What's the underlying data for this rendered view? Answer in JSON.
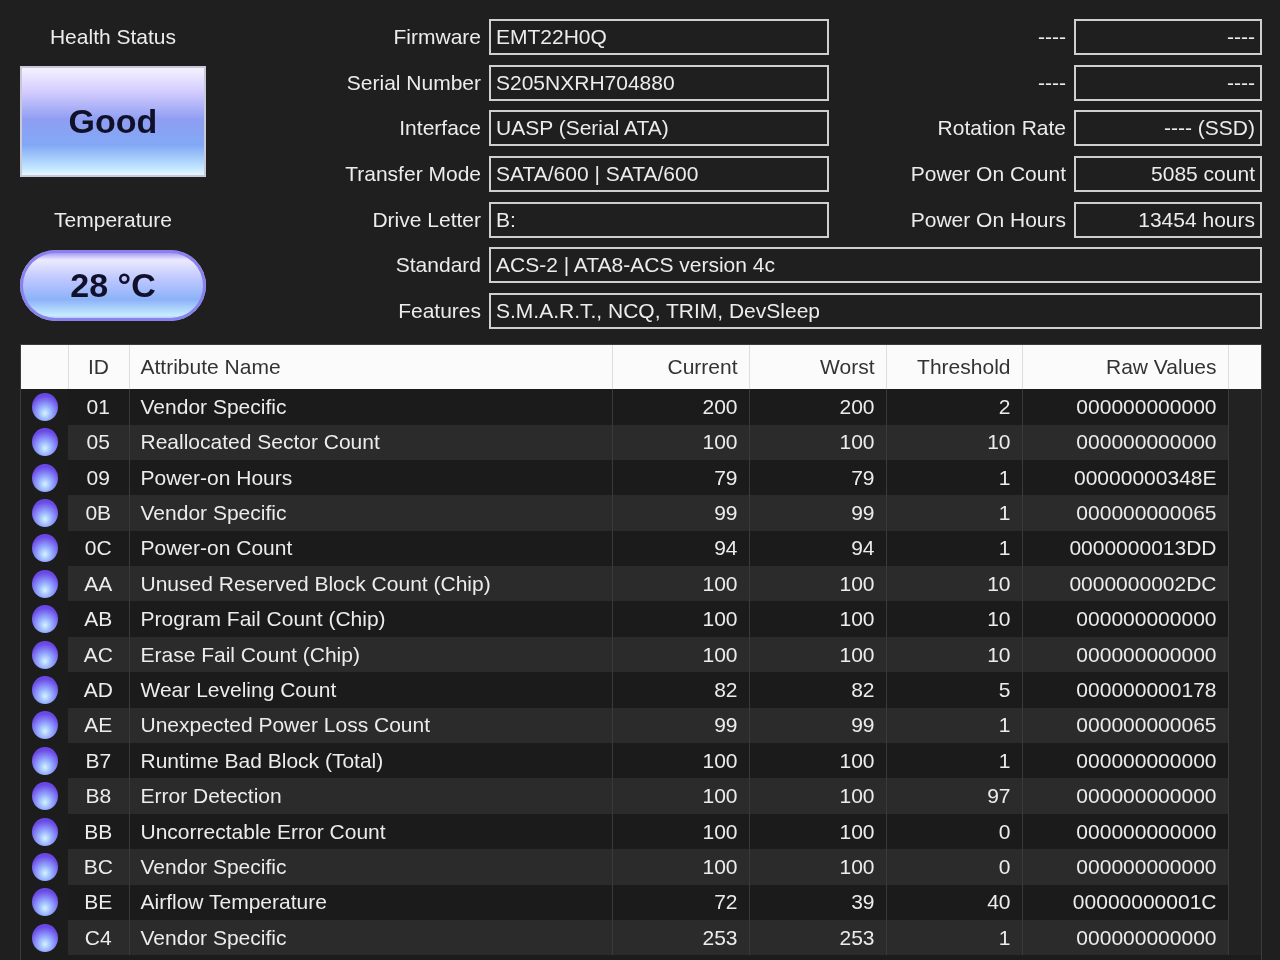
{
  "health_status": {
    "label": "Health Status",
    "value": "Good"
  },
  "temperature": {
    "label": "Temperature",
    "value": "28 °C"
  },
  "details": [
    {
      "label": "Firmware",
      "value": "EMT22H0Q"
    },
    {
      "label": "Serial Number",
      "value": "S205NXRH704880"
    },
    {
      "label": "Interface",
      "value": "UASP (Serial ATA)"
    },
    {
      "label": "Transfer Mode",
      "value": "SATA/600 | SATA/600"
    },
    {
      "label": "Drive Letter",
      "value": "B:"
    }
  ],
  "side_details": [
    {
      "label": "----",
      "value": "----"
    },
    {
      "label": "----",
      "value": "----"
    },
    {
      "label": "Rotation Rate",
      "value": "---- (SSD)"
    },
    {
      "label": "Power On Count",
      "value": "5085 count"
    },
    {
      "label": "Power On Hours",
      "value": "13454 hours"
    }
  ],
  "wide_details": [
    {
      "label": "Standard",
      "value": "ACS-2 | ATA8-ACS version 4c"
    },
    {
      "label": "Features",
      "value": "S.M.A.R.T., NCQ, TRIM, DevSleep"
    }
  ],
  "smart_table": {
    "columns": [
      "ID",
      "Attribute Name",
      "Current",
      "Worst",
      "Threshold",
      "Raw Values"
    ],
    "rows": [
      {
        "id": "01",
        "name": "Vendor Specific",
        "current": "200",
        "worst": "200",
        "threshold": "2",
        "raw": "000000000000"
      },
      {
        "id": "05",
        "name": "Reallocated Sector Count",
        "current": "100",
        "worst": "100",
        "threshold": "10",
        "raw": "000000000000"
      },
      {
        "id": "09",
        "name": "Power-on Hours",
        "current": "79",
        "worst": "79",
        "threshold": "1",
        "raw": "00000000348E"
      },
      {
        "id": "0B",
        "name": "Vendor Specific",
        "current": "99",
        "worst": "99",
        "threshold": "1",
        "raw": "000000000065"
      },
      {
        "id": "0C",
        "name": "Power-on Count",
        "current": "94",
        "worst": "94",
        "threshold": "1",
        "raw": "0000000013DD"
      },
      {
        "id": "AA",
        "name": "Unused Reserved Block Count (Chip)",
        "current": "100",
        "worst": "100",
        "threshold": "10",
        "raw": "0000000002DC"
      },
      {
        "id": "AB",
        "name": "Program Fail Count (Chip)",
        "current": "100",
        "worst": "100",
        "threshold": "10",
        "raw": "000000000000"
      },
      {
        "id": "AC",
        "name": "Erase Fail Count (Chip)",
        "current": "100",
        "worst": "100",
        "threshold": "10",
        "raw": "000000000000"
      },
      {
        "id": "AD",
        "name": "Wear Leveling Count",
        "current": "82",
        "worst": "82",
        "threshold": "5",
        "raw": "000000000178"
      },
      {
        "id": "AE",
        "name": "Unexpected Power Loss Count",
        "current": "99",
        "worst": "99",
        "threshold": "1",
        "raw": "000000000065"
      },
      {
        "id": "B7",
        "name": "Runtime Bad Block (Total)",
        "current": "100",
        "worst": "100",
        "threshold": "1",
        "raw": "000000000000"
      },
      {
        "id": "B8",
        "name": "Error Detection",
        "current": "100",
        "worst": "100",
        "threshold": "97",
        "raw": "000000000000"
      },
      {
        "id": "BB",
        "name": "Uncorrectable Error Count",
        "current": "100",
        "worst": "100",
        "threshold": "0",
        "raw": "000000000000"
      },
      {
        "id": "BC",
        "name": "Vendor Specific",
        "current": "100",
        "worst": "100",
        "threshold": "0",
        "raw": "000000000000"
      },
      {
        "id": "BE",
        "name": "Airflow Temperature",
        "current": "72",
        "worst": "39",
        "threshold": "40",
        "raw": "00000000001C"
      },
      {
        "id": "C4",
        "name": "Vendor Specific",
        "current": "253",
        "worst": "253",
        "threshold": "1",
        "raw": "000000000000"
      }
    ]
  }
}
